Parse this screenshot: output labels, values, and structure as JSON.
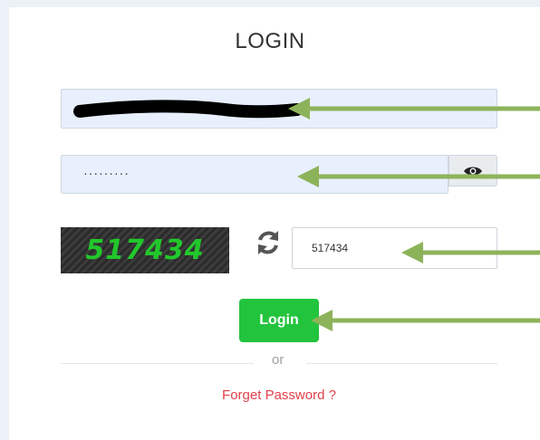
{
  "login": {
    "title": "LOGIN",
    "password_mask": "·········",
    "captcha_text": "517434",
    "captcha_input_value": "517434",
    "login_label": "Login",
    "or_label": "or",
    "forget_label": "Forget Password ?"
  },
  "icons": {
    "eye": "eye-icon",
    "refresh": "refresh-icon"
  },
  "colors": {
    "login_button": "#22c43d",
    "captcha_text": "#22c72b",
    "forget_link": "#e0404a",
    "arrow": "#8db35a"
  }
}
